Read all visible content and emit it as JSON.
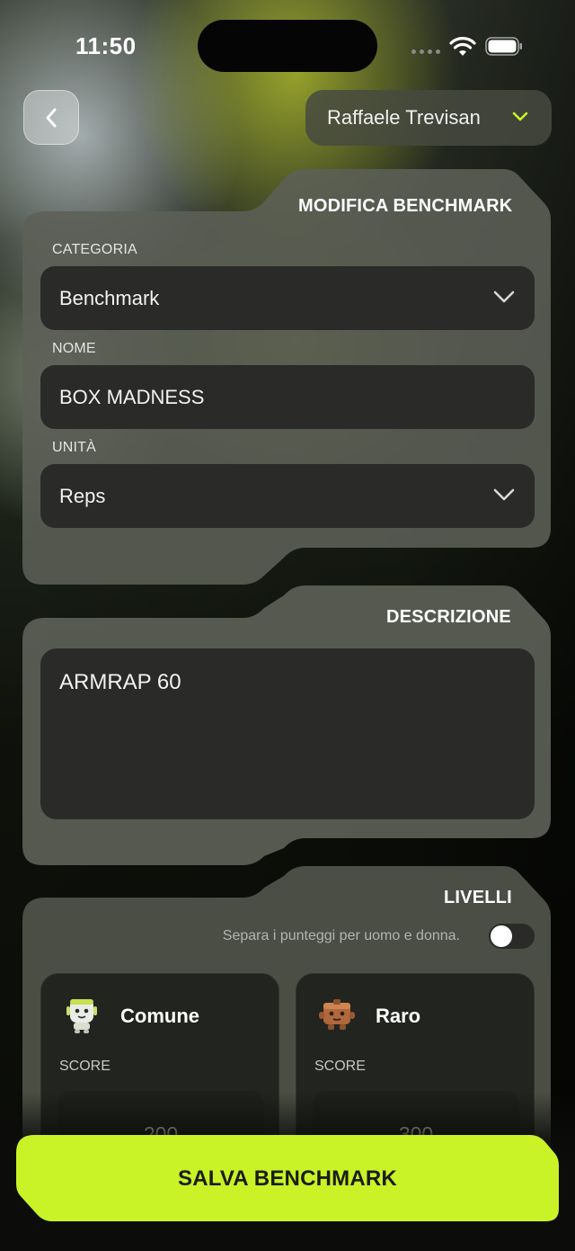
{
  "status_bar": {
    "time": "11:50"
  },
  "header": {
    "back_icon": "chevron-left-icon",
    "user_name": "Raffaele Trevisan",
    "accent_color": "#c9f227"
  },
  "edit_panel": {
    "title": "MODIFICA BENCHMARK",
    "category": {
      "label": "CATEGORIA",
      "value": "Benchmark"
    },
    "name": {
      "label": "NOME",
      "value": "BOX MADNESS"
    },
    "unit": {
      "label": "UNITÀ",
      "value": "Reps"
    }
  },
  "description_panel": {
    "title": "DESCRIZIONE",
    "value": "ARMRAP 60"
  },
  "levels_panel": {
    "title": "LIVELLI",
    "toggle_label": "Separa i punteggi per uomo e donna.",
    "toggle_on": false,
    "levels": [
      {
        "name": "Comune",
        "score_label": "SCORE",
        "score": "200",
        "icon": "white-robot-mascot-icon"
      },
      {
        "name": "Raro",
        "score_label": "SCORE",
        "score": "300",
        "icon": "brown-box-mascot-icon"
      }
    ]
  },
  "save_button": {
    "label": "SALVA BENCHMARK",
    "color": "#c9f227"
  }
}
